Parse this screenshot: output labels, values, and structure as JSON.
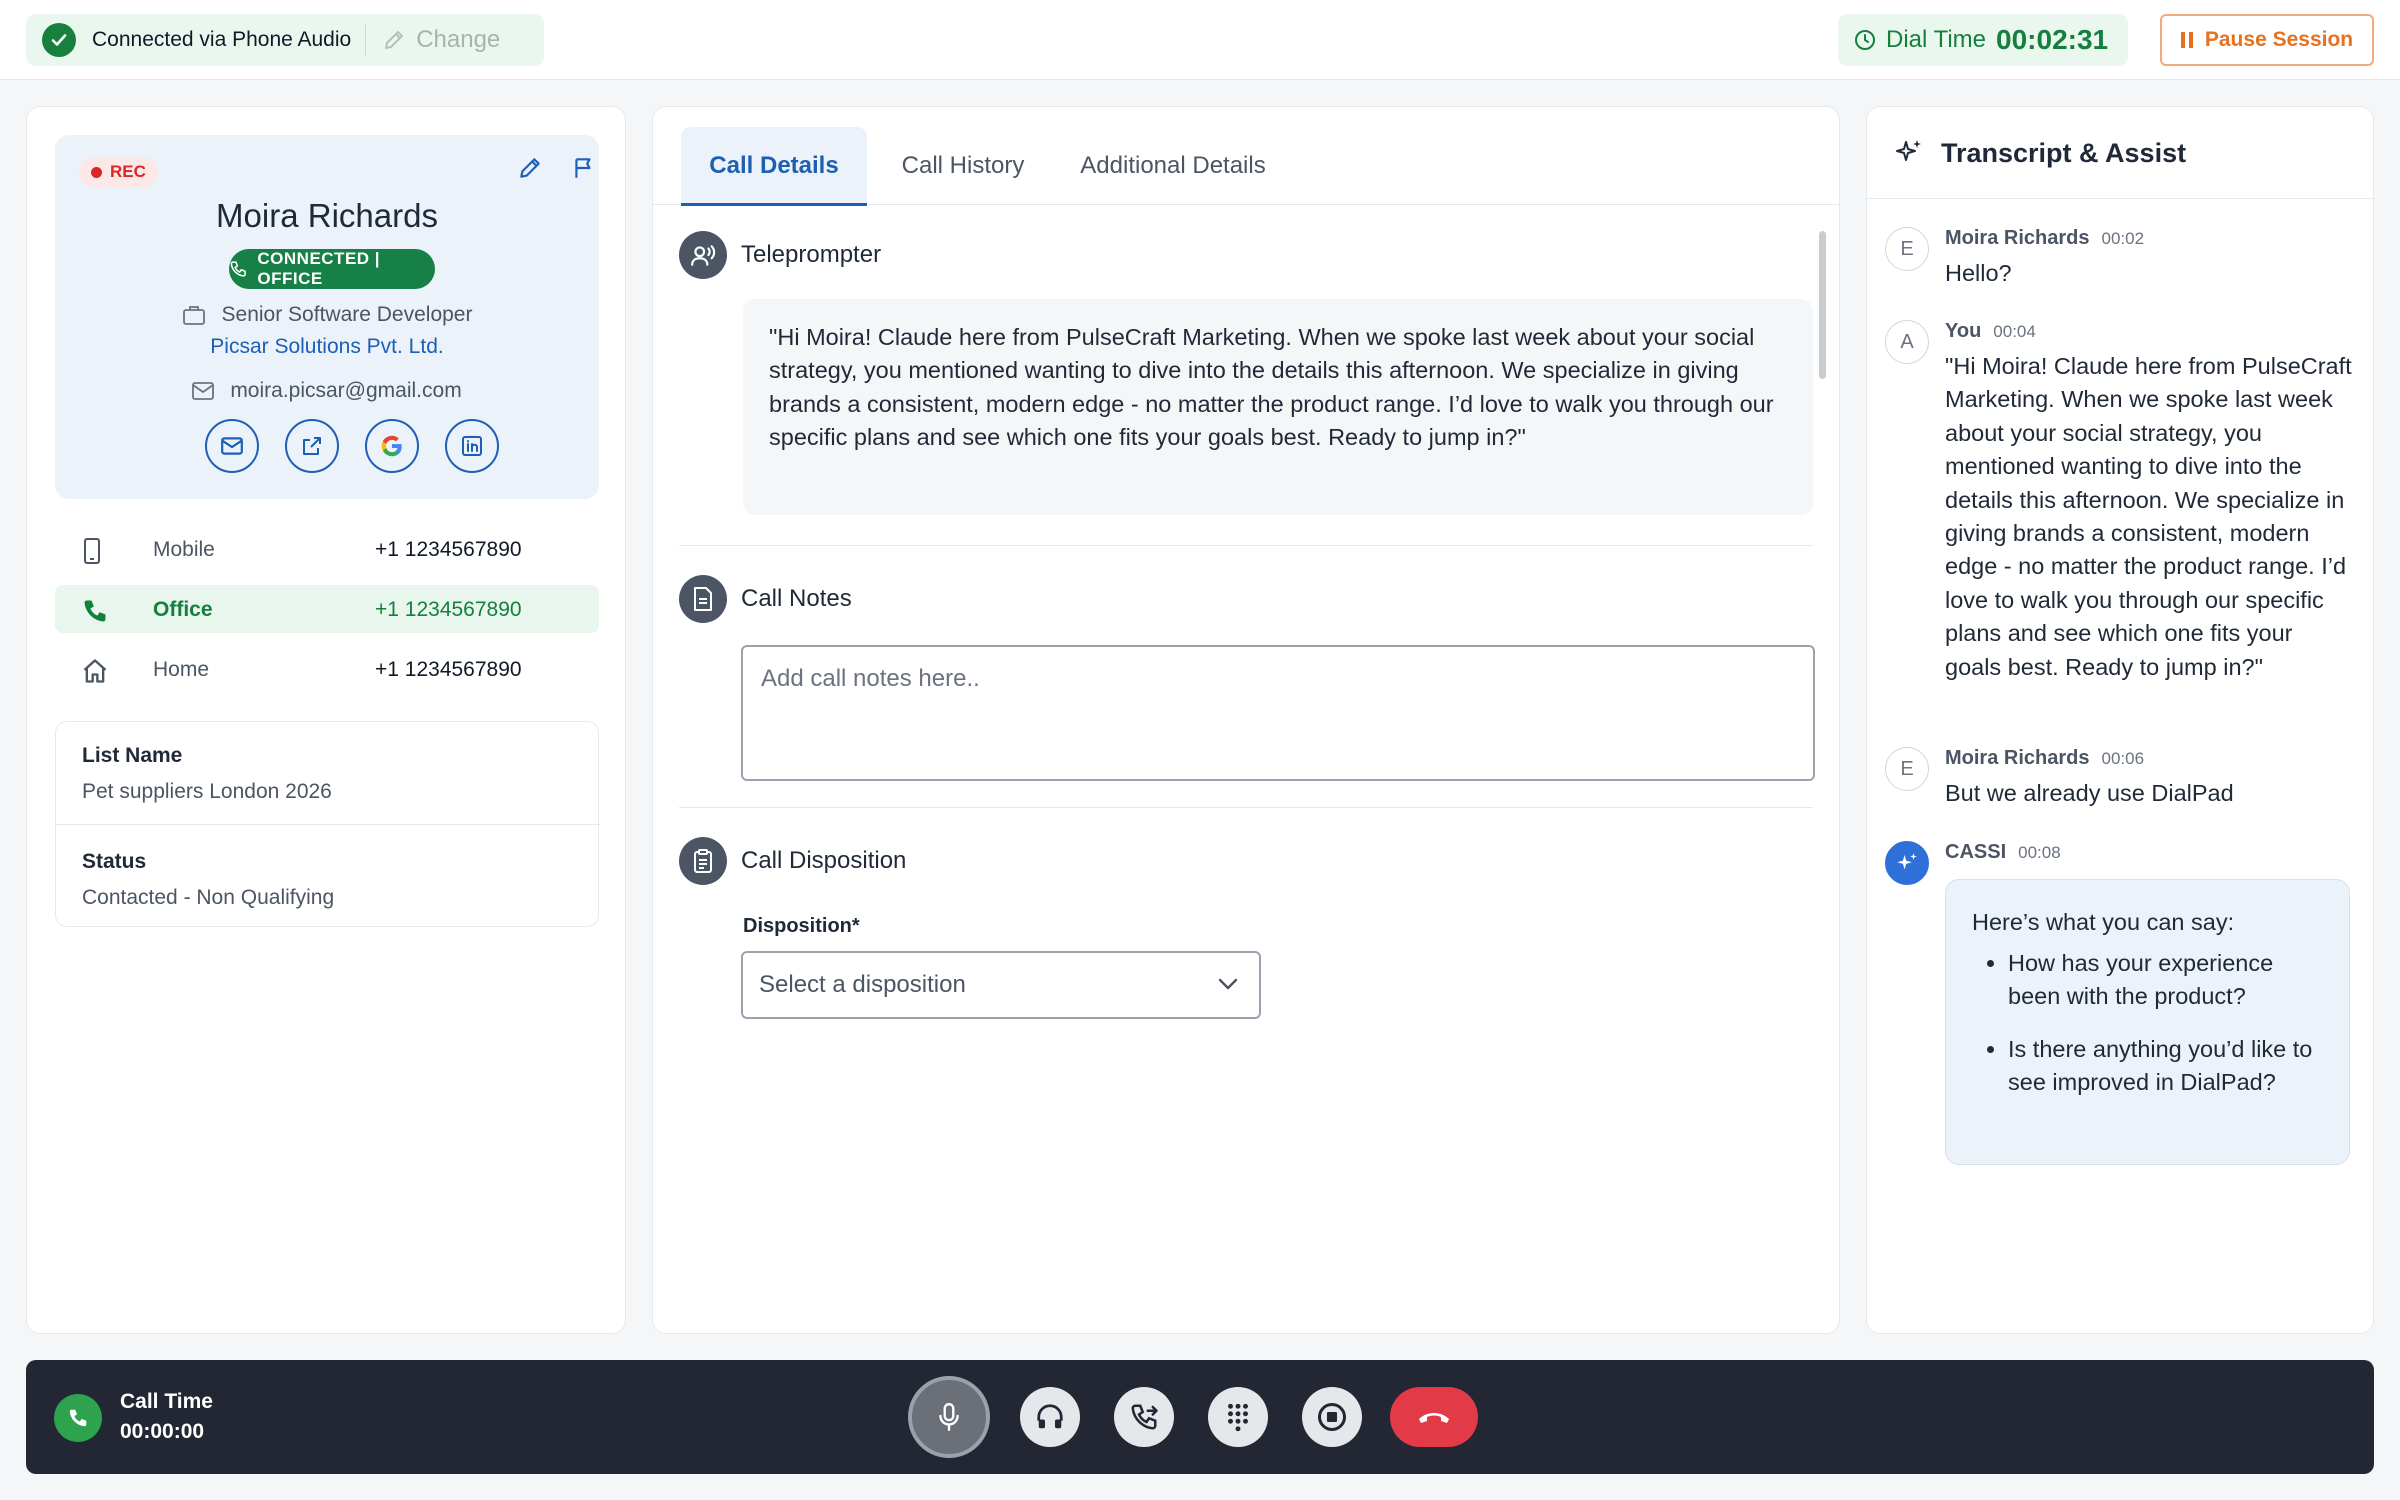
{
  "topbar": {
    "connection_text": "Connected via Phone Audio",
    "change_label": "Change",
    "dial_label": "Dial Time",
    "dial_time": "00:02:31",
    "pause_label": "Pause Session"
  },
  "contact": {
    "rec_label": "REC",
    "name": "Moira Richards",
    "status_badge": "CONNECTED | OFFICE",
    "title": "Senior Software Developer",
    "company": "Picsar Solutions Pvt. Ltd.",
    "email": "moira.picsar@gmail.com",
    "social_icons": [
      "mail-icon",
      "external-link-icon",
      "google-icon",
      "linkedin-icon"
    ],
    "phones": [
      {
        "label": "Mobile",
        "number": "+1 1234567890",
        "icon": "mobile-icon",
        "active": false
      },
      {
        "label": "Office",
        "number": "+1 1234567890",
        "icon": "phone-icon",
        "active": true
      },
      {
        "label": "Home",
        "number": "+1 1234567890",
        "icon": "home-icon",
        "active": false
      }
    ],
    "list_name_label": "List Name",
    "list_name": "Pet suppliers London 2026",
    "status_label": "Status",
    "status": "Contacted - Non Qualifying"
  },
  "main": {
    "tabs": [
      {
        "label": "Call Details",
        "active": true
      },
      {
        "label": "Call History",
        "active": false
      },
      {
        "label": "Additional Details",
        "active": false
      }
    ],
    "teleprompter_title": "Teleprompter",
    "teleprompter_text": "\"Hi Moira! Claude here from PulseCraft Marketing. When we spoke last week about your social strategy, you mentioned wanting to dive into the details this afternoon. We specialize in giving brands a consistent, modern edge - no matter the product range. I’d love to walk you through our specific plans and see which one fits your goals best. Ready to jump in?\"",
    "notes_title": "Call Notes",
    "notes_placeholder": "Add call notes here..",
    "notes_value": "",
    "disposition_title": "Call Disposition",
    "disposition_label": "Disposition*",
    "disposition_placeholder": "Select a disposition"
  },
  "transcript": {
    "title": "Transcript & Assist",
    "messages": [
      {
        "avatar": "E",
        "speaker": "Moira Richards",
        "time": "00:02",
        "text": "Hello?"
      },
      {
        "avatar": "A",
        "speaker": "You",
        "time": "00:04",
        "text": "\"Hi Moira! Claude here from PulseCraft Marketing. When we spoke last week about your social strategy, you mentioned wanting to dive into the details this afternoon. We specialize in giving brands a consistent, modern edge - no matter the product range. I’d love to walk you through our specific plans and see which one fits your goals best. Ready to jump in?\""
      },
      {
        "avatar": "E",
        "speaker": "Moira Richards",
        "time": "00:06",
        "text": "But we already use DialPad"
      }
    ],
    "assist": {
      "speaker": "CASSI",
      "time": "00:08",
      "intro": "Here’s what you can say:",
      "suggestions": [
        "How has your experience been with the product?",
        "Is there anything you’d like to see improved in DialPad?"
      ]
    }
  },
  "callbar": {
    "call_time_label": "Call Time",
    "call_time": "00:00:00",
    "controls": [
      "microphone-icon",
      "headset-icon",
      "call-transfer-icon",
      "dialpad-icon",
      "stop-record-icon",
      "hang-up-icon"
    ]
  },
  "colors": {
    "brand_blue": "#1d5fb5",
    "success_green": "#15803d",
    "warning_orange": "#e8711f",
    "danger_red": "#e23b47",
    "dark_bar": "#232733"
  }
}
